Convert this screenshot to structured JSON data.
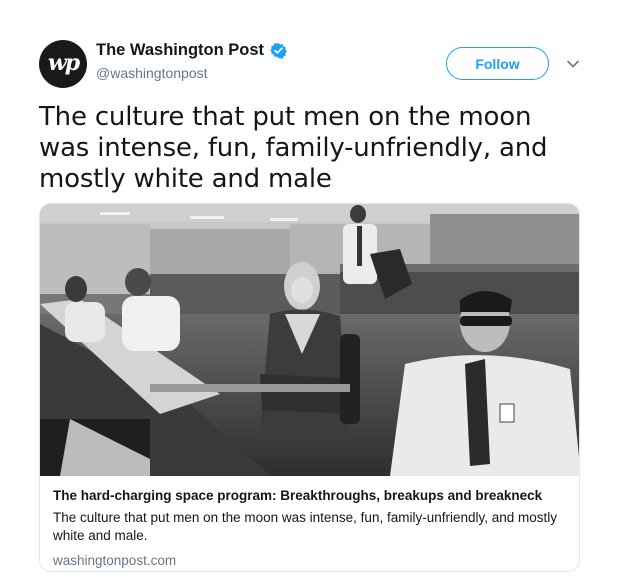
{
  "author": {
    "avatar_text": "wp",
    "display_name": "The Washington Post",
    "handle": "@washingtonpost",
    "verified": true
  },
  "actions": {
    "follow_label": "Follow",
    "menu_icon": "chevron-down-icon"
  },
  "tweet": {
    "text": "The culture that put men on the moon was intense, fun, family-unfriendly, and mostly white and male"
  },
  "card": {
    "image_icon": "photo",
    "title": "The hard-charging space program: Breakthroughs, breakups and breakneck",
    "description": "The culture that put men on the moon was intense, fun, family-unfriendly, and mostly white and male.",
    "domain": "washingtonpost.com"
  },
  "colors": {
    "accent": "#1da1f2",
    "secondary_text": "#657786",
    "border": "#e1e8ed"
  }
}
